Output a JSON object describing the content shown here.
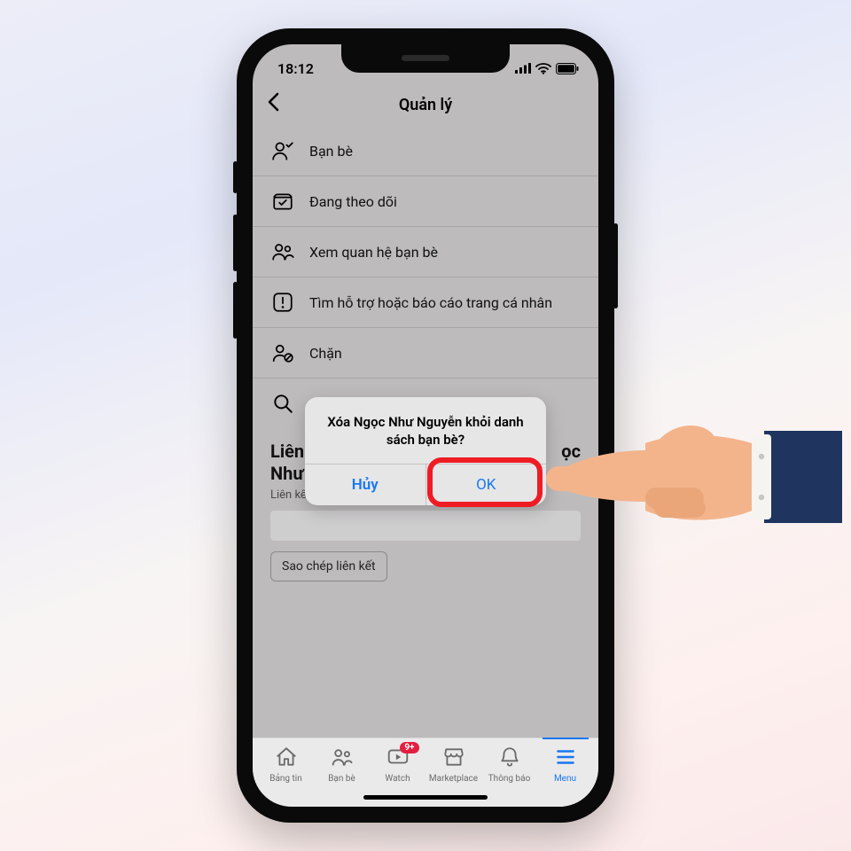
{
  "statusbar": {
    "time": "18:12"
  },
  "header": {
    "title": "Quản lý"
  },
  "rows": {
    "friends": "Bạn bè",
    "following": "Đang theo dõi",
    "mutual": "Xem quan hệ bạn bè",
    "report": "Tìm hỗ trợ hoặc báo cáo trang cá nhân",
    "block": "Chặn",
    "search": ""
  },
  "link_section": {
    "heading_line1": "Liên",
    "heading_line2": "Như",
    "heading_trail": "ọc",
    "subtitle": "Liên kết riêng của Ngọc Như trên Facebook.",
    "copy_label": "Sao chép liên kết"
  },
  "dialog": {
    "message": "Xóa Ngọc Như Nguyễn khỏi danh sách bạn bè?",
    "cancel": "Hủy",
    "ok": "OK"
  },
  "tabs": {
    "feed": "Bảng tin",
    "friends": "Bạn bè",
    "watch": "Watch",
    "watch_badge": "9+",
    "marketplace": "Marketplace",
    "notifications": "Thông báo",
    "menu": "Menu"
  }
}
